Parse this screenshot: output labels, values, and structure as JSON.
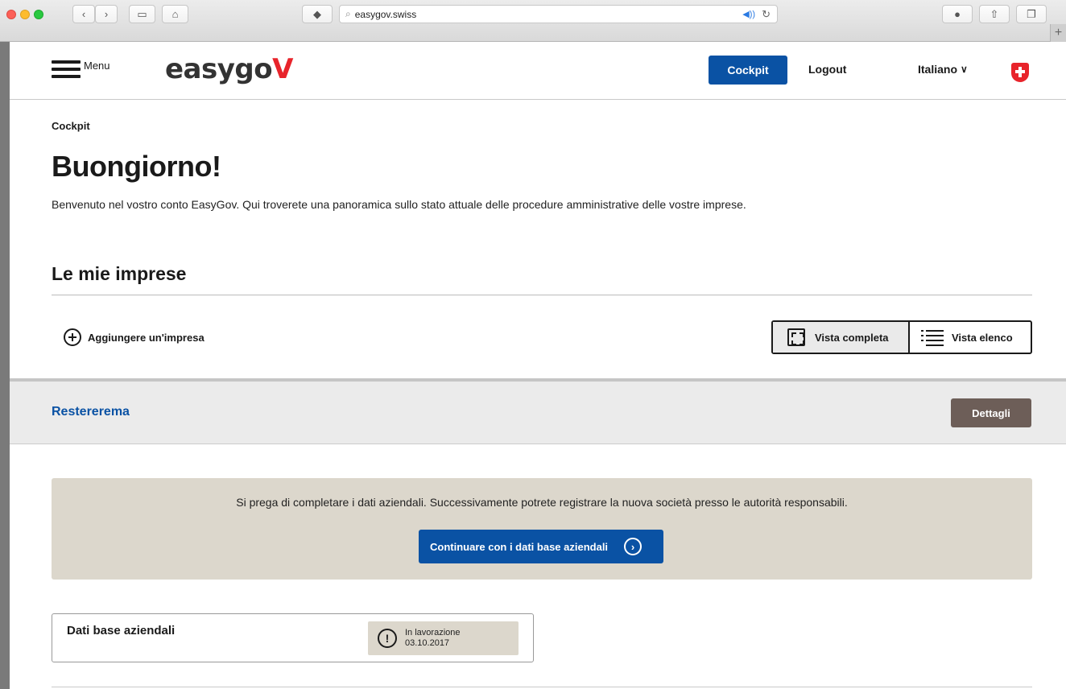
{
  "browser": {
    "address": "easygov.swiss",
    "new_tab": "+"
  },
  "header": {
    "menu_label": "Menu",
    "logo_text": "easygo",
    "logo_accent": "V",
    "cockpit_label": "Cockpit",
    "logout_label": "Logout",
    "language": "Italiano",
    "language_chevron": "∨"
  },
  "main": {
    "breadcrumb": "Cockpit",
    "greeting": "Buongiorno!",
    "welcome": "Benvenuto nel vostro conto EasyGov. Qui troverete una panoramica sullo stato attuale delle procedure amministrative delle vostre imprese.",
    "section_title": "Le mie imprese",
    "add_company_label": "Aggiungere un'impresa",
    "view_full_label": "Vista completa",
    "view_list_label": "Vista elenco"
  },
  "company": {
    "name": "Restererema",
    "details_label": "Dettagli",
    "notice_text": "Si prega di completare i dati aziendali. Successivamente potrete registrare la nuova società presso le autorità responsabili.",
    "continue_label": "Continuare con i dati base aziendali",
    "card_title": "Dati base aziendali",
    "status_label": "In lavorazione",
    "status_date": "03.10.2017"
  },
  "colors": {
    "brand_blue": "#0a52a4",
    "logo_red": "#e8242b",
    "details_brown": "#6d5e58",
    "notice_beige": "#dcd7cc"
  },
  "icons": [
    "hamburger-icon",
    "swiss-cross-icon",
    "plus-circle-icon",
    "expand-icon",
    "list-icon",
    "arrow-circle-icon",
    "exclamation-icon"
  ]
}
